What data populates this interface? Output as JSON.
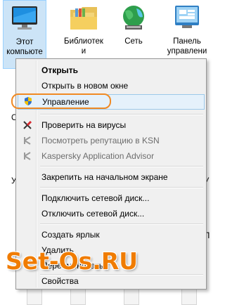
{
  "desktop": {
    "icons": [
      {
        "line1": "Этот",
        "line2": "компьюте"
      },
      {
        "line1": "Библиотек",
        "line2": "и"
      },
      {
        "line1": "Сеть",
        "line2": ""
      },
      {
        "line1": "Панель",
        "line2": "управлени"
      }
    ],
    "fragments": {
      "a": "С",
      "b": "У",
      "c": "У",
      "d": "П"
    }
  },
  "context_menu": {
    "open": "Открыть",
    "open_new_window": "Открыть в новом окне",
    "manage": "Управление",
    "scan_viruses": "Проверить на вирусы",
    "check_reputation": "Посмотреть репутацию в KSN",
    "kaspersky_advisor": "Kaspersky Application Advisor",
    "pin_start": "Закрепить на начальном экране",
    "map_drive": "Подключить сетевой диск...",
    "disconnect_drive": "Отключить сетевой диск...",
    "create_shortcut": "Создать ярлык",
    "delete": "Удалить",
    "rename": "Переименовать",
    "properties": "Свойства"
  },
  "watermark": "Set-Os.RU",
  "colors": {
    "highlight_outline": "#f08a24",
    "selection": "#cce4f7",
    "watermark": "#f07c00"
  }
}
